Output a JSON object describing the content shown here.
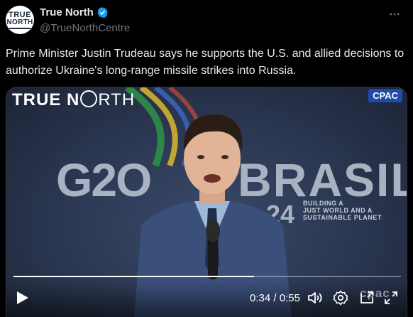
{
  "author": {
    "avatar_line1": "TRUE",
    "avatar_line2": "NORTH",
    "name": "True North",
    "handle": "@TrueNorthCentre"
  },
  "tweet": {
    "text": "Prime Minister Justin Trudeau says he supports the U.S. and allied decisions to authorize Ukraine's long-range missile strikes into Russia."
  },
  "video": {
    "watermark_bold": "TRUE N",
    "watermark_thin": "RTH",
    "cpac_badge": "CPAC",
    "backdrop_left": "G2O",
    "backdrop_right": "BRASIL",
    "backdrop_year": "24",
    "backdrop_tagline": [
      "BUILDING A",
      "JUST WORLD AND A",
      "SUSTAINABLE PLANET"
    ],
    "current_time": "0:34",
    "separator": "/",
    "duration": "0:55",
    "progress": 0.62,
    "corner_bug": "cpac"
  },
  "colors": {
    "background": "#000000",
    "text": "#e7e9ea",
    "secondary": "#71767b",
    "verified": "#1d9bf0",
    "cpac_blue": "#1f4aa8"
  },
  "icons": [
    "verified-badge-icon",
    "more-options-icon",
    "play-icon",
    "volume-icon",
    "settings-icon",
    "picture-in-picture-icon",
    "fullscreen-icon"
  ]
}
